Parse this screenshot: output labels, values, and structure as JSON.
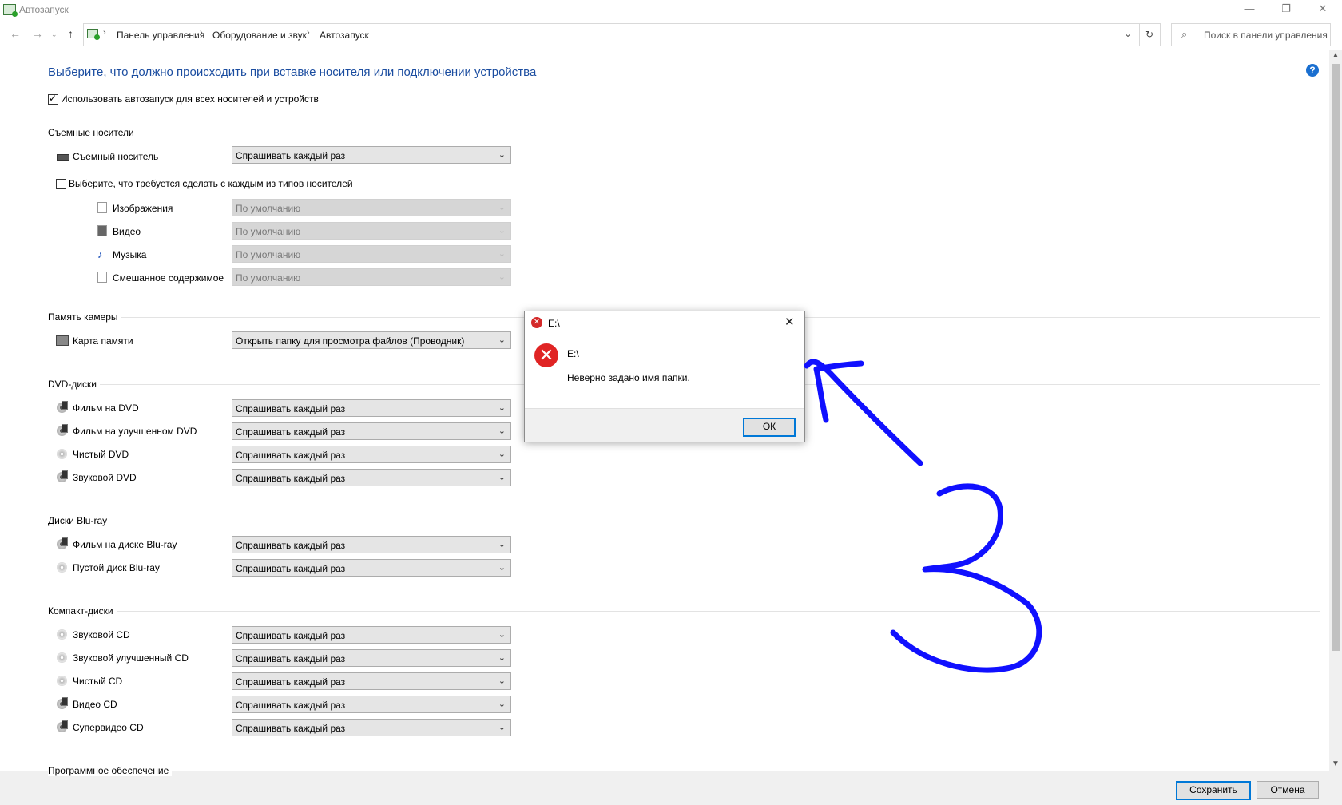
{
  "window": {
    "title": "Автозапуск"
  },
  "address": {
    "crumbs": [
      "Панель управления",
      "Оборудование и звук",
      "Автозапуск"
    ],
    "search_placeholder": "Поиск в панели управления"
  },
  "page": {
    "heading": "Выберите, что должно происходить при вставке носителя или подключении устройства",
    "use_autoplay_label": "Использовать автозапуск для всех носителей и устройств",
    "help": "?"
  },
  "removable": {
    "group": "Съемные носители",
    "device_label": "Съемный носитель",
    "device_value": "Спрашивать каждый раз",
    "choose_label": "Выберите, что требуется сделать с каждым из типов носителей",
    "types": [
      {
        "label": "Изображения",
        "value": "По умолчанию"
      },
      {
        "label": "Видео",
        "value": "По умолчанию"
      },
      {
        "label": "Музыка",
        "value": "По умолчанию"
      },
      {
        "label": "Смешанное содержимое",
        "value": "По умолчанию"
      }
    ]
  },
  "camera": {
    "group": "Память камеры",
    "items": [
      {
        "label": "Карта памяти",
        "value": "Открыть папку для просмотра файлов (Проводник)"
      }
    ]
  },
  "dvd": {
    "group": "DVD-диски",
    "items": [
      {
        "label": "Фильм на DVD",
        "value": "Спрашивать каждый раз"
      },
      {
        "label": "Фильм на улучшенном DVD",
        "value": "Спрашивать каждый раз"
      },
      {
        "label": "Чистый DVD",
        "value": "Спрашивать каждый раз"
      },
      {
        "label": "Звуковой DVD",
        "value": "Спрашивать каждый раз"
      }
    ]
  },
  "bluray": {
    "group": "Диски Blu-ray",
    "items": [
      {
        "label": "Фильм на диске Blu-ray",
        "value": "Спрашивать каждый раз"
      },
      {
        "label": "Пустой диск Blu-ray",
        "value": "Спрашивать каждый раз"
      }
    ]
  },
  "cd": {
    "group": "Компакт-диски",
    "items": [
      {
        "label": "Звуковой CD",
        "value": "Спрашивать каждый раз"
      },
      {
        "label": "Звуковой улучшенный CD",
        "value": "Спрашивать каждый раз"
      },
      {
        "label": "Чистый CD",
        "value": "Спрашивать каждый раз"
      },
      {
        "label": "Видео CD",
        "value": "Спрашивать каждый раз"
      },
      {
        "label": "Супервидео CD",
        "value": "Спрашивать каждый раз"
      }
    ]
  },
  "software": {
    "group": "Программное обеспечение"
  },
  "buttons": {
    "save": "Сохранить",
    "cancel": "Отмена"
  },
  "dialog": {
    "title": "E:\\",
    "line1": "E:\\",
    "message": "Неверно задано имя папки.",
    "ok": "ОК"
  },
  "colors": {
    "heading": "#1b4da0",
    "annotation": "#1010ff",
    "accent": "#0078d7",
    "error": "#e02424"
  }
}
